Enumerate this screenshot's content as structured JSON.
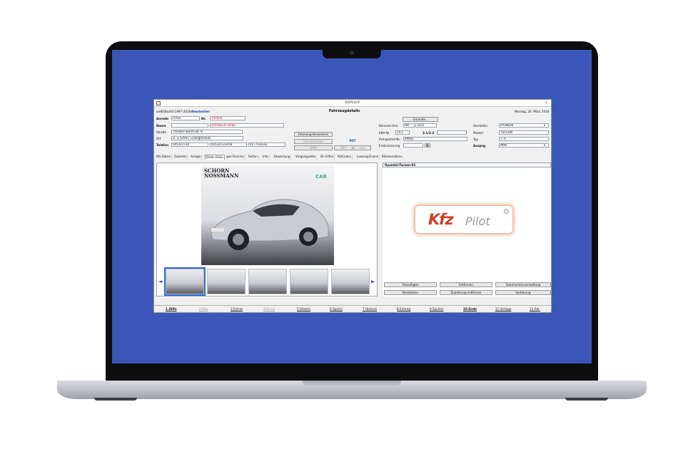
{
  "window": {
    "title": "KfzPilot®"
  },
  "header": {
    "copyright": "ariKfzBuilt©1997-2018",
    "mode": "Bearbeiten",
    "section_title": "Fahrzeugdetails",
    "date": "Montag, 26. März 2018",
    "record_id": "0848"
  },
  "customer": {
    "anrede_label": "Anrede",
    "anrede_value": "Firma",
    "nr_label": "Nr.",
    "nr_value": "100000",
    "name_label": "Name",
    "name_value": "ariKfzBuilt GmbH",
    "strasse_label": "Straße",
    "strasse_value": "Theodor-Storm-Str. 8",
    "ort_label": "Ort",
    "ort_country": "D",
    "ort_zip": "22941",
    "ort_city": "Bargteheide",
    "telefon_label": "Telefon",
    "tel1": "045322730",
    "tel2": "04532/123456",
    "tel3": "0177xxxxxx"
  },
  "middle_buttons": {
    "fahrzeug_verzeichnis": "Fahrzeug-Verzeichnis",
    "haendlerportal": "Händlerportal",
    "pot": "POT",
    "bmn": "BMN",
    "rep": "REP",
    "ich": "ICH"
  },
  "vehicle": {
    "garantie_button": "Garantie...",
    "kennzeichen_label": "Kennzeichen",
    "kennzeichen_1": "HH",
    "kennzeichen_2": "1555",
    "kba_label": "KBA-Nr.",
    "kba_value": "14.1",
    "kba_code": "2.1/2.2",
    "fahrgestell_label": "Fahrgestell-Nr.",
    "fahrgestell_value": "KMHJ5",
    "erstzulassung_label": "Erstzulassung",
    "erstzulassung_value": "",
    "hersteller_label": "Hersteller",
    "hersteller_value": "HYUNDAI",
    "modell_label": "Modell",
    "modell_value": "TUCSON",
    "typ_label": "Typ",
    "typ_value": "1.7L",
    "auspraegung_label": "Ausprg.",
    "auspraegung_value": "PKW"
  },
  "tabs": [
    "Kfz-Daten",
    "Zubehör",
    "Anlage",
    "Bilder,Doku",
    "gus.Termine",
    "Reifen",
    "Info",
    "Bewertung",
    "Vorgangsakte",
    "W.-Hilfen",
    "KfzCodes",
    "Leasing,Finanz",
    "Bilmsendaten"
  ],
  "photo_panel": {
    "showroom_logo_line1": "SCHORN",
    "showroom_logo_line2": "NOSSMANN",
    "green_logo": "CAR",
    "prev_arrow": "◄",
    "next_arrow": "►"
  },
  "document": {
    "caption": "Hyundai-Tucson-01",
    "logo_brand": "Kfz",
    "logo_product": "Pilot",
    "logo_mark": "R"
  },
  "doc_buttons": {
    "hinzufuegen": "Hinzufügen",
    "entfernen": "Entfernen",
    "dokumentenverwaltung": "Dokumentenverwaltung",
    "bearbeiten": "Bearbeiten",
    "zuordnung_entfernen": "Zuordnung entfernen",
    "sortierung": "Sortierung"
  },
  "fkeys": [
    "1.Hilfe",
    "2.Neu",
    "3.Extras",
    "4.Druck",
    "5.Stamm",
    "6.Speich",
    "7.Historie",
    "8.Eintrag",
    "9.Suchen",
    "10.Ende",
    "11.Vorlage",
    "12.Adr."
  ],
  "colors": {
    "screen_bg": "#3a56b8",
    "accent_red": "#c0202a",
    "link_blue": "#1d3fb8"
  }
}
